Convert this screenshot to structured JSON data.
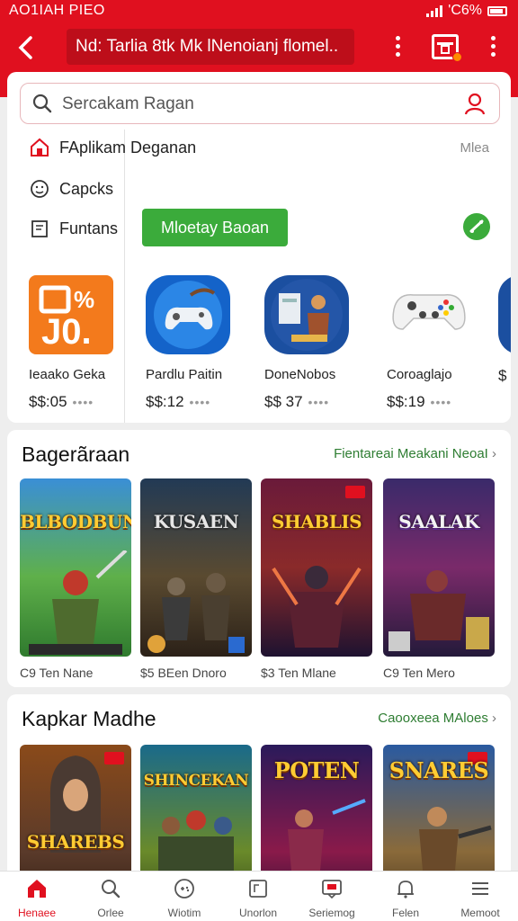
{
  "status": {
    "time": "AO1IAH PIEO",
    "battery": "'C6%"
  },
  "header": {
    "title": "Nd: Tarlia 8tk Mk lNenoianj flomel..",
    "colors": {
      "brand": "#e0101f",
      "title_field": "#bd0e1a",
      "badge": "#ff8a00"
    }
  },
  "search": {
    "placeholder": "Sercakam Ragan"
  },
  "sidebar": {
    "items": [
      {
        "label": "FAplikam Deganan",
        "icon": "home-icon"
      },
      {
        "label": "Capcks",
        "icon": "smile-icon"
      },
      {
        "label": "Funtans",
        "icon": "document-icon"
      }
    ],
    "more_label": "Mlea"
  },
  "promo": {
    "button_label": "Mloetay Baoan",
    "accent": "#3bab3b"
  },
  "apps": [
    {
      "name": "Ieaako Geka",
      "price": "$$:05",
      "dots": "••••"
    },
    {
      "name": "Pardlu Paitin",
      "price": "$$:12",
      "dots": "••••"
    },
    {
      "name": "DoneNobos",
      "price": "$$ 37",
      "dots": "••••"
    },
    {
      "name": "Coroaglajo",
      "price": "$$:19",
      "dots": "••••"
    },
    {
      "name": "",
      "price": "$",
      "dots": ""
    }
  ],
  "section1": {
    "title": "Bagerãraan",
    "link": "Fientareai Meakani NeoaI",
    "games": [
      {
        "art_title": "BLBODBUN",
        "meta": "C9 Ten Nane"
      },
      {
        "art_title": "KUSAEN",
        "meta": "$5 BEen Dnoro"
      },
      {
        "art_title": "SHABLIS",
        "meta": "$3 Ten Mlane"
      },
      {
        "art_title": "SAALAK",
        "meta": "C9 Ten Mero"
      }
    ]
  },
  "section2": {
    "title": "Kapkar Madhe",
    "link": "Caooxeea MAloes",
    "games": [
      {
        "art_title": "SHAREBS"
      },
      {
        "art_title": "SHINCEKAN"
      },
      {
        "art_title": "POTEN"
      },
      {
        "art_title": "SNARES"
      }
    ]
  },
  "bottom_nav": [
    {
      "label": "Henaee",
      "icon": "home-icon",
      "active": true
    },
    {
      "label": "Orlee",
      "icon": "search-icon",
      "active": false
    },
    {
      "label": "Wiotim",
      "icon": "gamepad-icon",
      "active": false
    },
    {
      "label": "Unorlon",
      "icon": "folder-icon",
      "active": false
    },
    {
      "label": "Seriemog",
      "icon": "message-icon",
      "active": false
    },
    {
      "label": "Felen",
      "icon": "bell-icon",
      "active": false
    },
    {
      "label": "Memoot",
      "icon": "menu-icon",
      "active": false
    }
  ]
}
